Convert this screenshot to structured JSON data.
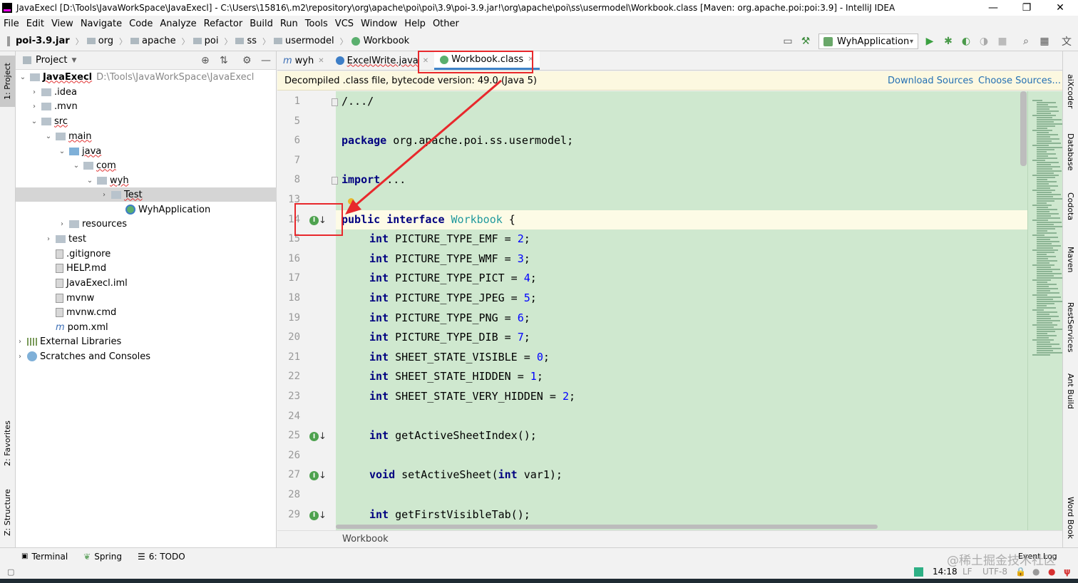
{
  "window": {
    "title": "JavaExecl [D:\\Tools\\JavaWorkSpace\\JavaExecl] - C:\\Users\\15816\\.m2\\repository\\org\\apache\\poi\\poi\\3.9\\poi-3.9.jar!\\org\\apache\\poi\\ss\\usermodel\\Workbook.class [Maven: org.apache.poi:poi:3.9] - IntelliJ IDEA",
    "minimize": "—",
    "maximize": "❐",
    "close": "✕"
  },
  "menu": [
    "File",
    "Edit",
    "View",
    "Navigate",
    "Code",
    "Analyze",
    "Refactor",
    "Build",
    "Run",
    "Tools",
    "VCS",
    "Window",
    "Help",
    "Other"
  ],
  "breadcrumbs": [
    "poi-3.9.jar",
    "org",
    "apache",
    "poi",
    "ss",
    "usermodel",
    "Workbook"
  ],
  "run_config": "WyhApplication",
  "left_tools": [
    "1: Project",
    "2: Favorites",
    "Z: Structure"
  ],
  "project": {
    "header": "Project",
    "tree": [
      {
        "label": "JavaExecl",
        "hint": "D:\\Tools\\JavaWorkSpace\\JavaExecl"
      },
      {
        "label": ".idea"
      },
      {
        "label": ".mvn"
      },
      {
        "label": "src"
      },
      {
        "label": "main"
      },
      {
        "label": "java"
      },
      {
        "label": "com"
      },
      {
        "label": "wyh"
      },
      {
        "label": "Test"
      },
      {
        "label": "WyhApplication"
      },
      {
        "label": "resources"
      },
      {
        "label": "test"
      },
      {
        "label": ".gitignore"
      },
      {
        "label": "HELP.md"
      },
      {
        "label": "JavaExecl.iml"
      },
      {
        "label": "mvnw"
      },
      {
        "label": "mvnw.cmd"
      },
      {
        "label": "pom.xml"
      },
      {
        "label": "External Libraries"
      },
      {
        "label": "Scratches and Consoles"
      }
    ]
  },
  "tabs": [
    "wyh",
    "ExcelWrite.java",
    "Workbook.class"
  ],
  "decompiled": {
    "message": "Decompiled .class file, bytecode version: 49.0 (Java 5)",
    "download": "Download Sources",
    "choose": "Choose Sources..."
  },
  "code": {
    "line_numbers": [
      "1",
      "5",
      "6",
      "7",
      "8",
      "13",
      "14",
      "15",
      "16",
      "17",
      "18",
      "19",
      "20",
      "21",
      "22",
      "23",
      "24",
      "25",
      "26",
      "27",
      "28",
      "29"
    ],
    "lines": [
      {
        "n": "1",
        "text": "/.../"
      },
      {
        "n": "5",
        "text": ""
      },
      {
        "n": "6",
        "kw": "package",
        "text": " org.apache.poi.ss.usermodel;"
      },
      {
        "n": "7",
        "text": ""
      },
      {
        "n": "8",
        "kw": "import",
        "text": " ..."
      },
      {
        "n": "13",
        "text": ""
      },
      {
        "n": "14",
        "kw": "public interface",
        "iface": "Workbook",
        "text": " {"
      },
      {
        "n": "15",
        "kw": "int",
        "text": " PICTURE_TYPE_EMF = ",
        "num": "2",
        "end": ";"
      },
      {
        "n": "16",
        "kw": "int",
        "text": " PICTURE_TYPE_WMF = ",
        "num": "3",
        "end": ";"
      },
      {
        "n": "17",
        "kw": "int",
        "text": " PICTURE_TYPE_PICT = ",
        "num": "4",
        "end": ";"
      },
      {
        "n": "18",
        "kw": "int",
        "text": " PICTURE_TYPE_JPEG = ",
        "num": "5",
        "end": ";"
      },
      {
        "n": "19",
        "kw": "int",
        "text": " PICTURE_TYPE_PNG = ",
        "num": "6",
        "end": ";"
      },
      {
        "n": "20",
        "kw": "int",
        "text": " PICTURE_TYPE_DIB = ",
        "num": "7",
        "end": ";"
      },
      {
        "n": "21",
        "kw": "int",
        "text": " SHEET_STATE_VISIBLE = ",
        "num": "0",
        "end": ";"
      },
      {
        "n": "22",
        "kw": "int",
        "text": " SHEET_STATE_HIDDEN = ",
        "num": "1",
        "end": ";"
      },
      {
        "n": "23",
        "kw": "int",
        "text": " SHEET_STATE_VERY_HIDDEN = ",
        "num": "2",
        "end": ";"
      },
      {
        "n": "24",
        "text": ""
      },
      {
        "n": "25",
        "kw": "int",
        "text": " getActiveSheetIndex();"
      },
      {
        "n": "26",
        "text": ""
      },
      {
        "n": "27",
        "kw": "void",
        "text": " setActiveSheet(",
        "kw2": "int",
        "text2": " var1);"
      },
      {
        "n": "28",
        "text": ""
      },
      {
        "n": "29",
        "kw": "int",
        "text": " getFirstVisibleTab();"
      }
    ]
  },
  "editor_breadcrumb": "Workbook",
  "right_tools": [
    "aiXcoder",
    "Database",
    "Codota",
    "Maven",
    "RestServices",
    "Ant Build",
    "Word Book"
  ],
  "bottom_tools": [
    "Terminal",
    "Spring",
    "6: TODO"
  ],
  "event_log": "Event Log",
  "status": {
    "position": "14:18",
    "line_sep": "LF",
    "encoding": "UTF-8"
  },
  "watermark": "@稀土掘金技术社区",
  "colors": {
    "annotation": "#e8282c",
    "editor_bg": "#cfe8cf",
    "keyword": "#000080",
    "number": "#0000ff"
  }
}
